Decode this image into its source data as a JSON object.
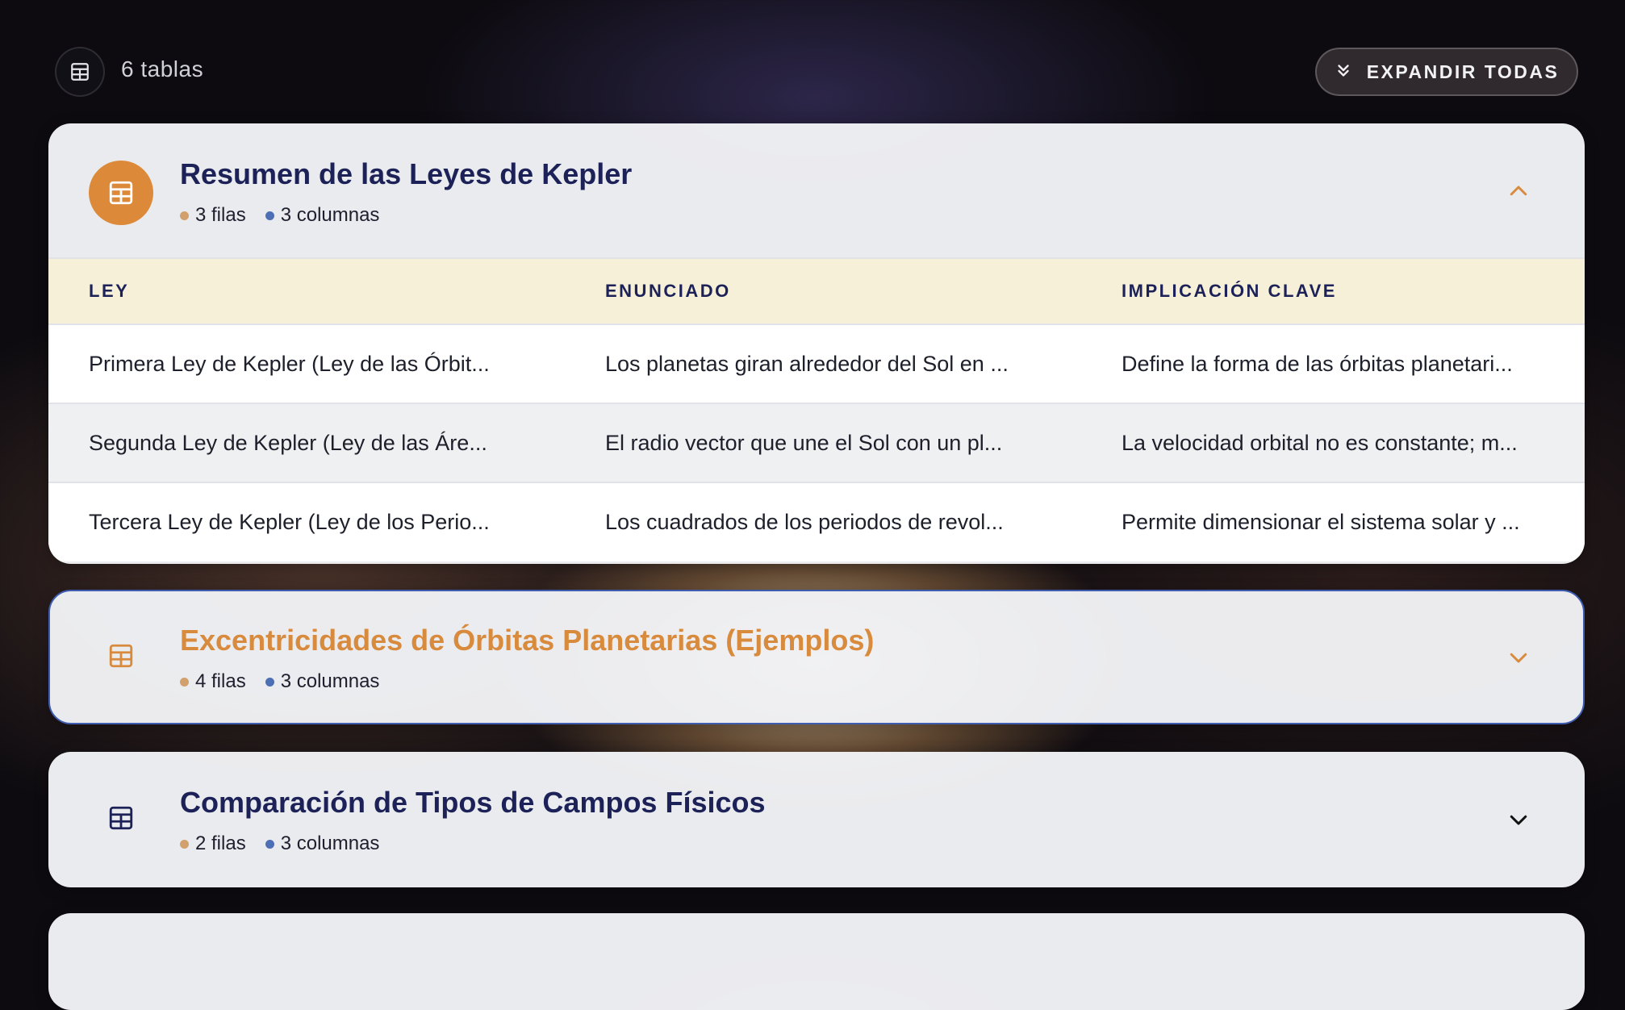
{
  "toolbar": {
    "table_count_label": "6 tablas",
    "expand_all_label": "EXPANDIR TODAS"
  },
  "tables": [
    {
      "title": "Resumen de las Leyes de Kepler",
      "rows_label": "3 filas",
      "cols_label": "3 columnas",
      "expanded": true,
      "headers": [
        "LEY",
        "ENUNCIADO",
        "IMPLICACIÓN CLAVE"
      ],
      "rows": [
        [
          "Primera Ley de Kepler (Ley de las Órbit...",
          "Los planetas giran alrededor del Sol en ...",
          "Define la forma de las órbitas planetari..."
        ],
        [
          "Segunda Ley de Kepler (Ley de las Áre...",
          "El radio vector que une el Sol con un pl...",
          "La velocidad orbital no es constante; m..."
        ],
        [
          "Tercera Ley de Kepler (Ley de los Perio...",
          "Los cuadrados de los periodos de revol...",
          "Permite dimensionar el sistema solar y ..."
        ]
      ]
    },
    {
      "title": "Excentricidades de Órbitas Planetarias (Ejemplos)",
      "rows_label": "4 filas",
      "cols_label": "3 columnas",
      "expanded": false
    },
    {
      "title": "Comparación de Tipos de Campos Físicos",
      "rows_label": "2 filas",
      "cols_label": "3 columnas",
      "expanded": false
    }
  ],
  "colors": {
    "accent_orange": "#dc8a3a",
    "title_navy": "#1c2257",
    "header_row_bg": "#f6f0d9",
    "selected_border": "#3e5cb0"
  },
  "icons": {
    "table": "table-grid-icon",
    "expand_all": "double-chevron-down-icon",
    "collapse": "chevron-up-icon",
    "expand": "chevron-down-icon"
  }
}
